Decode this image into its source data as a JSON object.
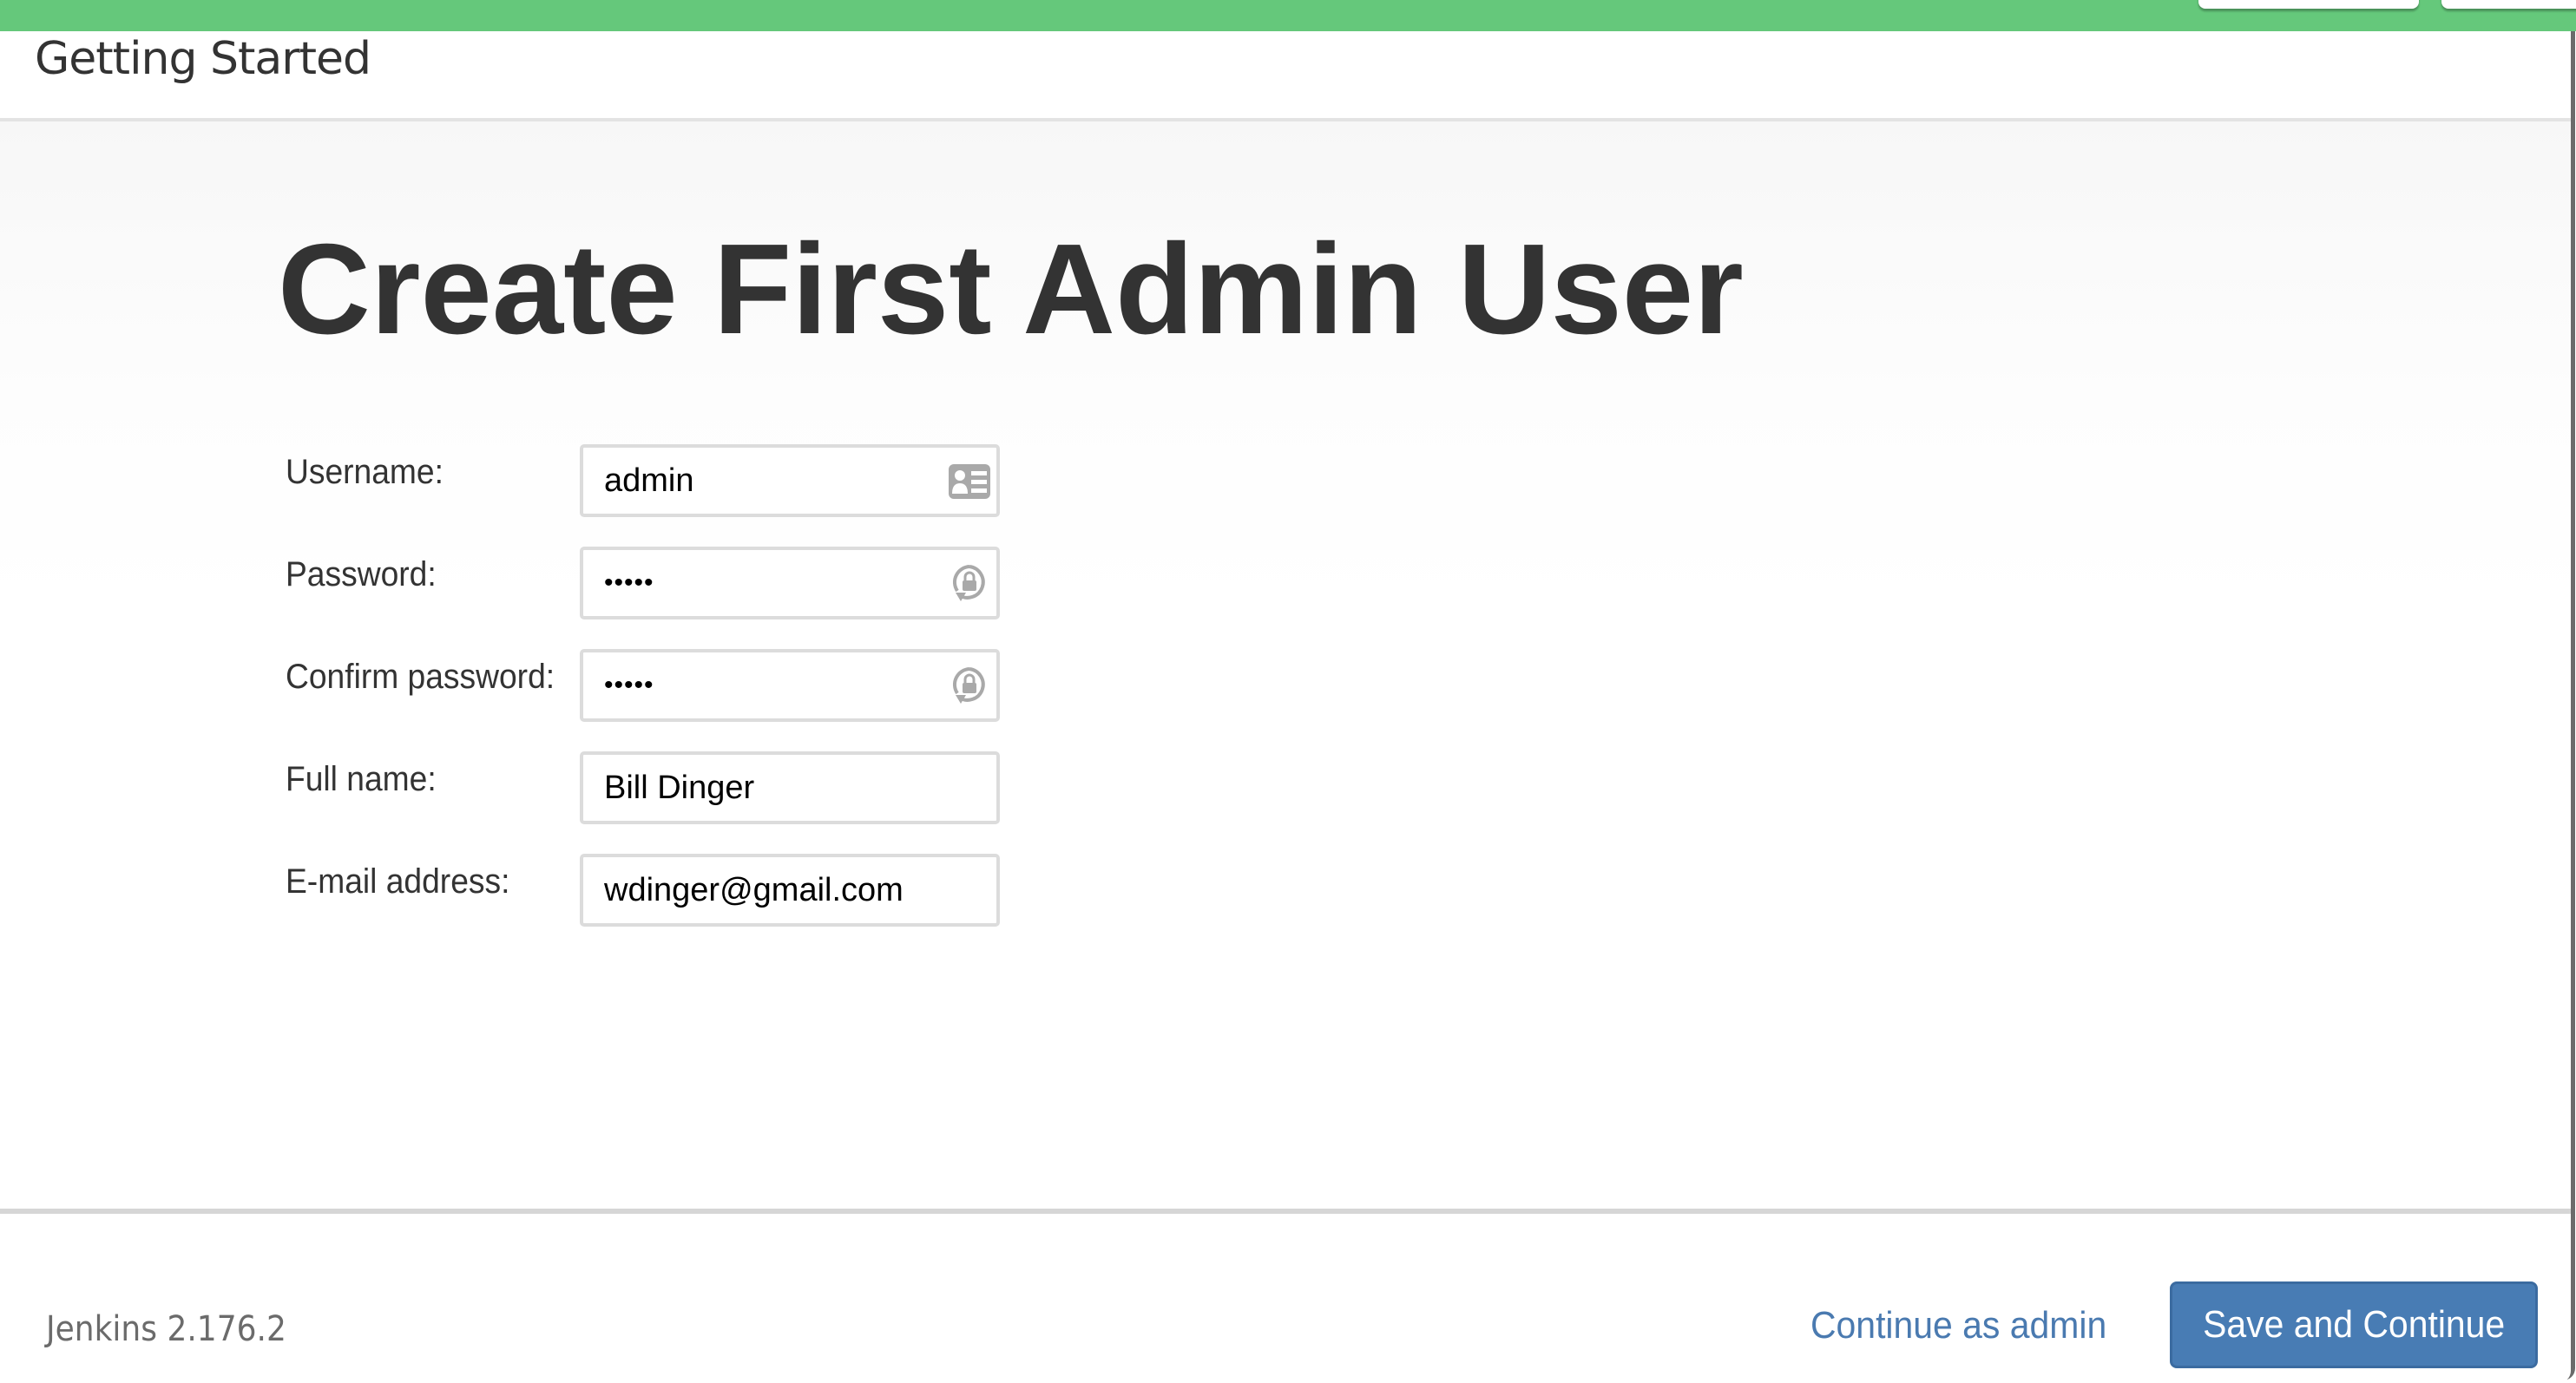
{
  "app": {
    "brand_color": "#65c87b",
    "header_title": "Getting Started"
  },
  "main": {
    "title": "Create First Admin User",
    "form": {
      "fields": [
        {
          "label": "Username:",
          "value": "admin",
          "type": "text",
          "icon": "contact-card-icon"
        },
        {
          "label": "Password:",
          "value": "•••••",
          "type": "password",
          "icon": "lock-refresh-icon"
        },
        {
          "label": "Confirm password:",
          "value": "•••••",
          "type": "password",
          "icon": "lock-refresh-icon"
        },
        {
          "label": "Full name:",
          "value": "Bill Dinger",
          "type": "text",
          "icon": null
        },
        {
          "label": "E-mail address:",
          "value": "wdinger@gmail.com",
          "type": "text",
          "icon": null
        }
      ]
    }
  },
  "footer": {
    "version": "Jenkins 2.176.2",
    "continue_link": "Continue as admin",
    "save_button": "Save and Continue",
    "link_color": "#4a7ab0",
    "button_color": "#487cb4"
  }
}
